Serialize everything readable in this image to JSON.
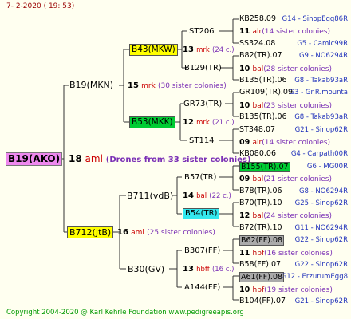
{
  "header": {
    "date": "7-  2-2020  ( 19:  53)"
  },
  "root": {
    "name": "B19(AKO)",
    "count": "18",
    "group": "aml",
    "note": "(Drones from 33 sister colonies)"
  },
  "gen1": [
    {
      "name": "B19(MKN)",
      "count": "15",
      "group": "mrk",
      "note": "(30 sister colonies)"
    },
    {
      "name": "B712(JtB)",
      "count": "16",
      "group": "aml",
      "note": "(25 sister colonies)"
    }
  ],
  "gen2": [
    {
      "name": "B43(MKW)",
      "count": "13",
      "group": "mrk",
      "note": "(24 c.)"
    },
    {
      "name": "B53(MKK)",
      "count": "12",
      "group": "mrk",
      "note": "(21 c.)"
    },
    {
      "name": "B711(vdB)",
      "count": "14",
      "group": "bal",
      "note": "(22 c.)"
    },
    {
      "name": "B30(GV)",
      "count": "13",
      "group": "hbff",
      "note": "(16 c.)"
    }
  ],
  "gen3": [
    {
      "name": "ST206"
    },
    {
      "name": "B129(TR)"
    },
    {
      "name": "GR73(TR)"
    },
    {
      "name": "ST114"
    },
    {
      "name": "B57(TR)"
    },
    {
      "name": "B54(TR)"
    },
    {
      "name": "B307(FF)"
    },
    {
      "name": "A144(FF)"
    }
  ],
  "gen4": [
    {
      "type": "queen",
      "name": "KB258.09",
      "id": "G14 - SinopEgg86R"
    },
    {
      "type": "colonies",
      "count": "11",
      "group": "alr",
      "note": "(14 sister colonies)"
    },
    {
      "type": "queen",
      "name": "SS324.08",
      "id": "G5 - Camic99R"
    },
    {
      "type": "queen",
      "name": "B82(TR).07",
      "id": "G9 - NO6294R"
    },
    {
      "type": "colonies",
      "count": "10",
      "group": "bal",
      "note": "(28 sister colonies)"
    },
    {
      "type": "queen",
      "name": "B135(TR).06",
      "id": "G8 - Takab93aR"
    },
    {
      "type": "queen",
      "name": "GR109(TR).09",
      "id": "G3 - Gr.R.mounta"
    },
    {
      "type": "colonies",
      "count": "10",
      "group": "bal",
      "note": "(23 sister colonies)"
    },
    {
      "type": "queen",
      "name": "B135(TR).06",
      "id": "G8 - Takab93aR"
    },
    {
      "type": "queen",
      "name": "ST348.07",
      "id": "G21 - Sinop62R"
    },
    {
      "type": "colonies",
      "count": "09",
      "group": "alr",
      "note": "(14 sister colonies)"
    },
    {
      "type": "queen",
      "name": "KB080.06",
      "id": "G4 - Carpath00R"
    },
    {
      "type": "queen",
      "name": "B155(TR).07",
      "id": "G6 - MG00R",
      "hl": "g"
    },
    {
      "type": "colonies",
      "count": "09",
      "group": "bal",
      "note": "(21 sister colonies)"
    },
    {
      "type": "queen",
      "name": "B78(TR).06",
      "id": "G8 - NO6294R"
    },
    {
      "type": "queen",
      "name": "B70(TR).10",
      "id": "G25 - Sinop62R"
    },
    {
      "type": "colonies",
      "count": "12",
      "group": "bal",
      "note": "(24 sister colonies)"
    },
    {
      "type": "queen",
      "name": "B72(TR).10",
      "id": "G11 - NO6294R"
    },
    {
      "type": "queen",
      "name": "B62(FF).08",
      "id": "G22 - Sinop62R",
      "hl": "grey"
    },
    {
      "type": "colonies",
      "count": "11",
      "group": "hbf",
      "note": "(16 sister colonies)"
    },
    {
      "type": "queen",
      "name": "B58(FF).07",
      "id": "G22 - Sinop62R"
    },
    {
      "type": "queen",
      "name": "A61(FF).08",
      "id": "G12 - ErzurumEgg8",
      "hl": "grey"
    },
    {
      "type": "colonies",
      "count": "10",
      "group": "hbf",
      "note": "(19 sister colonies)"
    },
    {
      "type": "queen",
      "name": "B104(FF).07",
      "id": "G21 - Sinop62R"
    }
  ],
  "footer": {
    "copyright": "Copyright 2004-2020 @ Karl Kehrle Foundation    www.pedigreeapis.org"
  }
}
